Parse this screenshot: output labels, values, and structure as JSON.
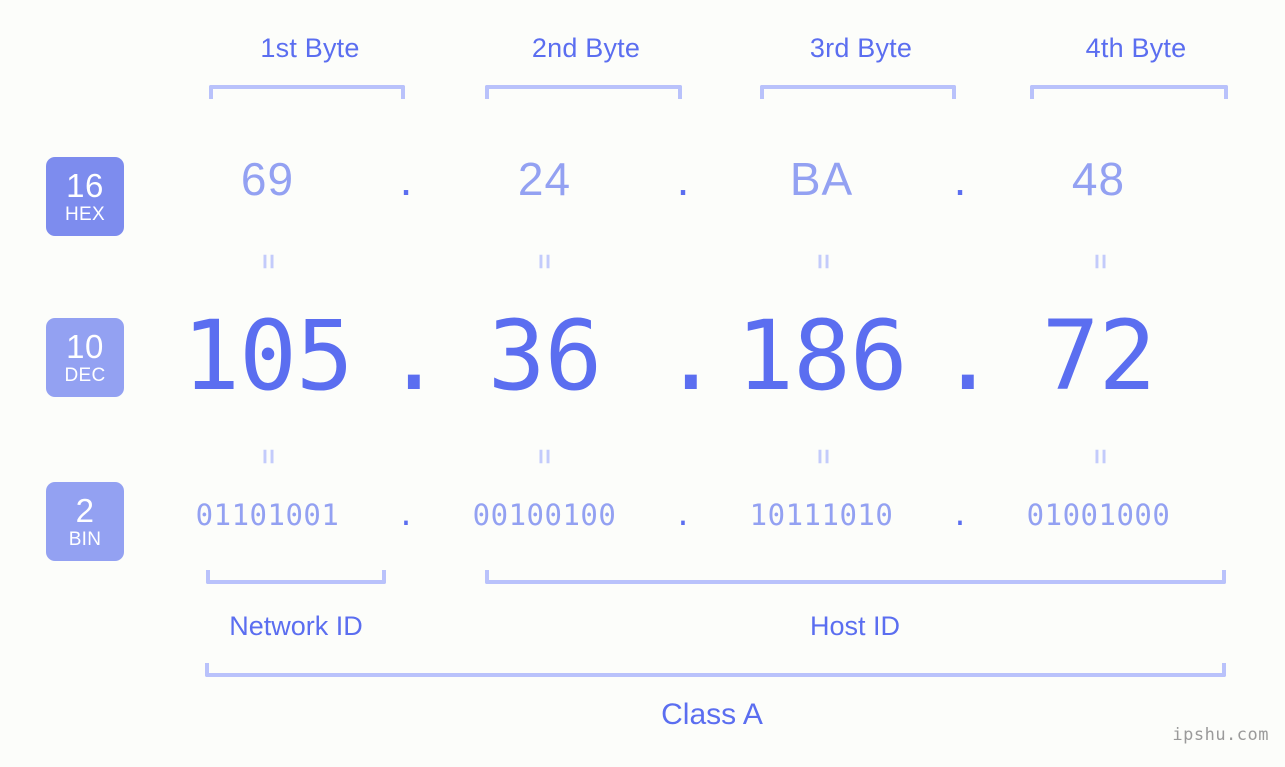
{
  "background_color": "#fcfdfa",
  "accent_color": "#5b6ef0",
  "accent_light_color": "#93a1f2",
  "bracket_color": "#b9c2fb",
  "badge_color": "#7d8cee",
  "header": {
    "byte_labels": [
      "1st Byte",
      "2nd Byte",
      "3rd Byte",
      "4th Byte"
    ]
  },
  "rows": [
    {
      "badge_number": "16",
      "badge_name": "HEX",
      "values": [
        "69",
        "24",
        "BA",
        "48"
      ],
      "separator": "."
    },
    {
      "badge_number": "10",
      "badge_name": "DEC",
      "values": [
        "105",
        "36",
        "186",
        "72"
      ],
      "separator": "."
    },
    {
      "badge_number": "2",
      "badge_name": "BIN",
      "values": [
        "01101001",
        "00100100",
        "10111010",
        "01001000"
      ],
      "separator": "."
    }
  ],
  "equality_mark": "=",
  "footer": {
    "network_id_label": "Network ID",
    "host_id_label": "Host ID",
    "class_label": "Class A"
  },
  "watermark": "ipshu.com"
}
